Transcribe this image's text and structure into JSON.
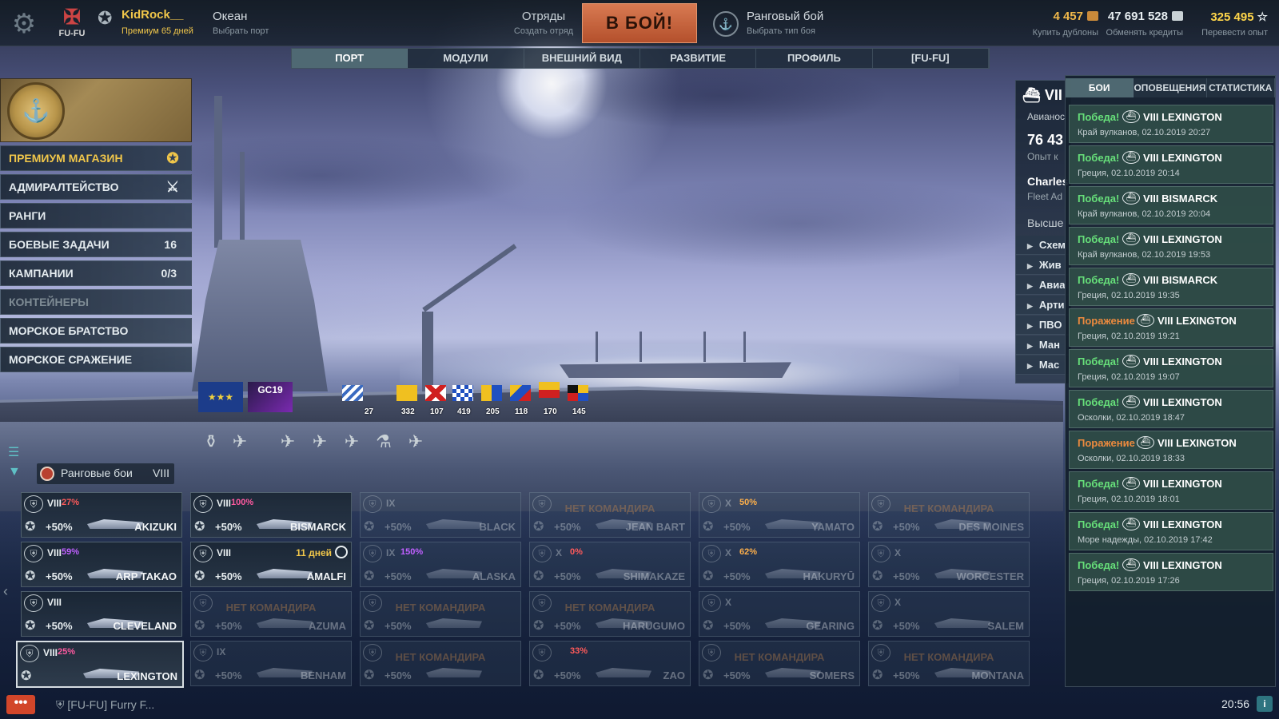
{
  "header": {
    "clan_tag": "FU-FU",
    "username": "KidRock__",
    "premium": "Премиум 65 дней",
    "port_name": "Океан",
    "port_sub": "Выбрать порт",
    "squad": "Отряды",
    "squad_sub": "Создать отряд",
    "battle_button": "В БОЙ!",
    "mode_title": "Ранговый бой",
    "mode_sub": "Выбрать тип боя",
    "doubloons": "4 457",
    "doubloons_sub": "Купить дублоны",
    "credits": "47 691 528",
    "credits_sub": "Обменять кредиты",
    "free_xp": "325 495",
    "free_xp_sub": "Перевести опыт",
    "colors": {
      "doubloons": "#f0b84a",
      "credits": "#e6edf0",
      "free_xp": "#ffd64a",
      "accent": "#d87a52"
    }
  },
  "nav_tabs": [
    "ПОРТ",
    "МОДУЛИ",
    "ВНЕШНИЙ ВИД",
    "РАЗВИТИЕ",
    "ПРОФИЛЬ",
    "[FU-FU]"
  ],
  "left_menu": {
    "items": [
      {
        "label": "ПРЕМИУМ МАГАЗИН",
        "count": "",
        "icon": "premium-shop-icon"
      },
      {
        "label": "АДМИРАЛТЕЙСТВО",
        "count": "",
        "icon": "admiralty-icon"
      },
      {
        "label": "РАНГИ",
        "count": ""
      },
      {
        "label": "БОЕВЫЕ ЗАДАЧИ",
        "count": "16"
      },
      {
        "label": "КАМПАНИИ",
        "count": "0/3"
      },
      {
        "label": "КОНТЕЙНЕРЫ",
        "count": ""
      },
      {
        "label": "МОРСКОЕ БРАТСТВО",
        "count": ""
      },
      {
        "label": "МОРСКОЕ СРАЖЕНИЕ",
        "count": ""
      }
    ]
  },
  "flags": {
    "patch": "GC19",
    "counts": [
      "27",
      "332",
      "107",
      "419",
      "205",
      "118",
      "170",
      "145"
    ]
  },
  "filter": {
    "mode": "Ранговые бои",
    "tier": "VIII"
  },
  "carousel": {
    "cards": [
      {
        "tier": "VIII",
        "bonus": "27%",
        "bonus_color": "#ff5a5a",
        "mult": "+50%",
        "name": "AKIZUKI",
        "state": "normal"
      },
      {
        "tier": "VIII",
        "bonus": "100%",
        "bonus_color": "#ff5aa0",
        "mult": "+50%",
        "name": "BISMARCK",
        "state": "normal"
      },
      {
        "tier": "IX",
        "bonus": "",
        "bonus_color": "#ffffff",
        "mult": "+50%",
        "name": "BLACK",
        "state": "ghost"
      },
      {
        "tier": "",
        "bonus": "",
        "bonus_color": "#ffffff",
        "mult": "+50%",
        "name": "JEAN BART",
        "state": "ghost",
        "nocmd": "НЕТ КОМАНДИРА"
      },
      {
        "tier": "X",
        "bonus": "50%",
        "bonus_color": "#ffb04a",
        "mult": "+50%",
        "name": "YAMATO",
        "state": "ghost"
      },
      {
        "tier": "",
        "bonus": "",
        "bonus_color": "#ffffff",
        "mult": "+50%",
        "name": "DES MOINES",
        "state": "ghost",
        "nocmd": "НЕТ КОМАНДИРА"
      },
      {
        "tier": "VIII",
        "bonus": "59%",
        "bonus_color": "#c060ff",
        "mult": "+50%",
        "name": "ARP TAKAO",
        "state": "normal"
      },
      {
        "tier": "VIII",
        "bonus": "",
        "bonus_color": "#ffffff",
        "mult": "+50%",
        "name": "AMALFI",
        "state": "normal",
        "days": "11 дней"
      },
      {
        "tier": "IX",
        "bonus": "150%",
        "bonus_color": "#c060ff",
        "mult": "+50%",
        "name": "ALASKA",
        "state": "ghost"
      },
      {
        "tier": "X",
        "bonus": "0%",
        "bonus_color": "#ff5a5a",
        "mult": "+50%",
        "name": "SHIMAKAZE",
        "state": "ghost"
      },
      {
        "tier": "X",
        "bonus": "62%",
        "bonus_color": "#ffb04a",
        "mult": "+50%",
        "name": "HAKURYŪ",
        "state": "ghost"
      },
      {
        "tier": "X",
        "bonus": "",
        "bonus_color": "#ffffff",
        "mult": "+50%",
        "name": "WORCESTER",
        "state": "ghost"
      },
      {
        "tier": "VIII",
        "bonus": "",
        "bonus_color": "#ffffff",
        "mult": "+50%",
        "name": "CLEVELAND",
        "state": "normal"
      },
      {
        "tier": "",
        "bonus": "",
        "bonus_color": "#ffffff",
        "mult": "+50%",
        "name": "AZUMA",
        "state": "ghost",
        "nocmd": "НЕТ КОМАНДИРА"
      },
      {
        "tier": "",
        "bonus": "",
        "bonus_color": "#ffffff",
        "mult": "+50%",
        "name": "",
        "state": "ghost",
        "nocmd": "НЕТ КОМАНДИРА"
      },
      {
        "tier": "",
        "bonus": "",
        "bonus_color": "#ffffff",
        "mult": "+50%",
        "name": "HARUGUMO",
        "state": "ghost",
        "nocmd": "НЕТ КОМАНДИРА"
      },
      {
        "tier": "X",
        "bonus": "",
        "bonus_color": "#ffffff",
        "mult": "+50%",
        "name": "GEARING",
        "state": "ghost"
      },
      {
        "tier": "X",
        "bonus": "",
        "bonus_color": "#ffffff",
        "mult": "+50%",
        "name": "SALEM",
        "state": "ghost"
      },
      {
        "tier": "VIII",
        "bonus": "25%",
        "bonus_color": "#ff5aa0",
        "mult": "",
        "name": "LEXINGTON",
        "state": "selected"
      },
      {
        "tier": "IX",
        "bonus": "",
        "bonus_color": "#ffffff",
        "mult": "+50%",
        "name": "BENHAM",
        "state": "ghost"
      },
      {
        "tier": "",
        "bonus": "",
        "bonus_color": "#ffffff",
        "mult": "+50%",
        "name": "",
        "state": "ghost",
        "nocmd": "НЕТ КОМАНДИРА"
      },
      {
        "tier": "",
        "bonus": "33%",
        "bonus_color": "#ff5a5a",
        "mult": "+50%",
        "name": "ZAO",
        "state": "ghost"
      },
      {
        "tier": "",
        "bonus": "",
        "bonus_color": "#ffffff",
        "mult": "+50%",
        "name": "SOMERS",
        "state": "ghost",
        "nocmd": "НЕТ КОМАНДИРА"
      },
      {
        "tier": "",
        "bonus": "",
        "bonus_color": "#ffffff",
        "mult": "+50%",
        "name": "MONTANA",
        "state": "ghost",
        "nocmd": "НЕТ КОМАНДИРА"
      }
    ]
  },
  "ship_info": {
    "tier": "VII",
    "class": "Авианос",
    "xp": "76 43",
    "xp_label": "Опыт к",
    "commander": "Charles",
    "commander_rank": "Fleet Ad",
    "highest": "Высше",
    "rows": [
      "Схем",
      "Жив",
      "Авиа",
      "Арти",
      "ПВО",
      "Ман",
      "Mac"
    ]
  },
  "notifications": {
    "tabs": [
      "БОИ",
      "ОПОВЕЩЕНИЯ",
      "СТАТИСТИКА"
    ],
    "items": [
      {
        "result": "Победа!",
        "win": true,
        "ship": "VIII LEXINGTON",
        "meta": "Край вулканов, 02.10.2019 20:27"
      },
      {
        "result": "Победа!",
        "win": true,
        "ship": "VIII LEXINGTON",
        "meta": "Греция, 02.10.2019 20:14"
      },
      {
        "result": "Победа!",
        "win": true,
        "ship": "VIII BISMARCK",
        "meta": "Край вулканов, 02.10.2019 20:04"
      },
      {
        "result": "Победа!",
        "win": true,
        "ship": "VIII LEXINGTON",
        "meta": "Край вулканов, 02.10.2019 19:53"
      },
      {
        "result": "Победа!",
        "win": true,
        "ship": "VIII BISMARCK",
        "meta": "Греция, 02.10.2019 19:35"
      },
      {
        "result": "Поражение",
        "win": false,
        "ship": "VIII LEXINGTON",
        "meta": "Греция, 02.10.2019 19:21"
      },
      {
        "result": "Победа!",
        "win": true,
        "ship": "VIII LEXINGTON",
        "meta": "Греция, 02.10.2019 19:07"
      },
      {
        "result": "Победа!",
        "win": true,
        "ship": "VIII LEXINGTON",
        "meta": "Осколки, 02.10.2019 18:47"
      },
      {
        "result": "Поражение",
        "win": false,
        "ship": "VIII LEXINGTON",
        "meta": "Осколки, 02.10.2019 18:33"
      },
      {
        "result": "Победа!",
        "win": true,
        "ship": "VIII LEXINGTON",
        "meta": "Греция, 02.10.2019 18:01"
      },
      {
        "result": "Победа!",
        "win": true,
        "ship": "VIII LEXINGTON",
        "meta": "Море надежды, 02.10.2019 17:42"
      },
      {
        "result": "Победа!",
        "win": true,
        "ship": "VIII LEXINGTON",
        "meta": "Греция, 02.10.2019 17:26"
      }
    ]
  },
  "bottom": {
    "chat_button": "•••",
    "chat_text": "[FU-FU] Furry F...",
    "time": "20:56",
    "info": "i"
  }
}
